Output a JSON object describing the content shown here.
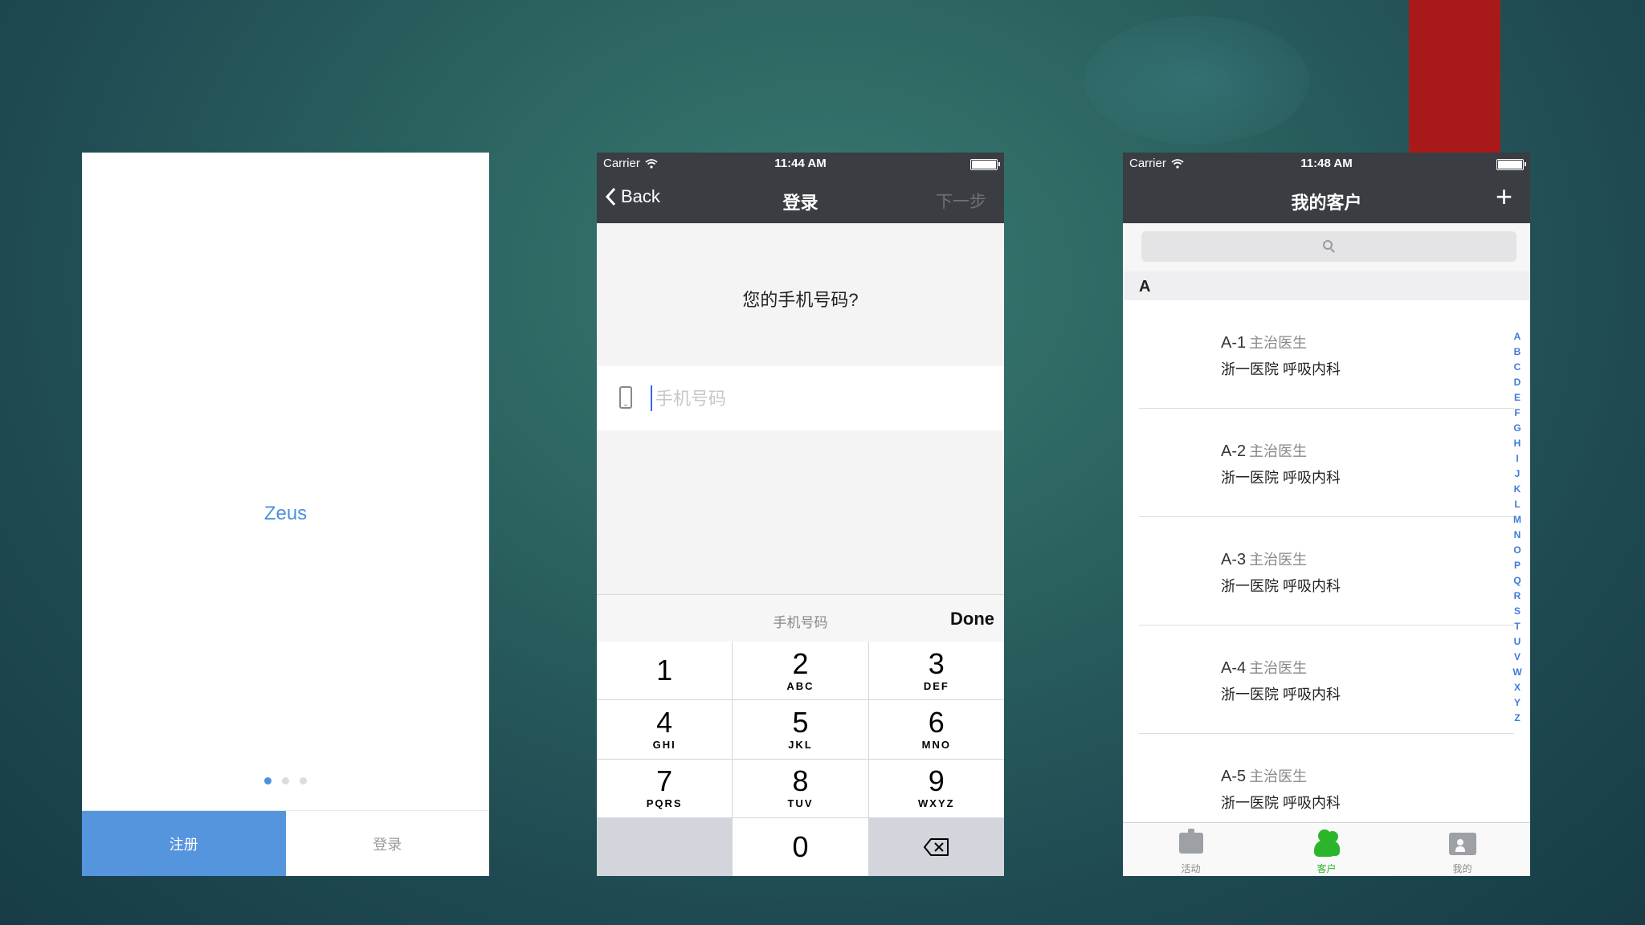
{
  "colors": {
    "background": "#2b6360",
    "accent_blue": "#4a90e2",
    "register_button": "#5595de",
    "navbar": "#3a3d42",
    "tab_active": "#2bb52b",
    "red_tab": "#a81a1a",
    "index_blue": "#3f7bd8"
  },
  "welcome": {
    "brand": "Zeus",
    "page_count": 3,
    "active_page": 1,
    "register_label": "注册",
    "login_label": "登录"
  },
  "login": {
    "status": {
      "carrier": "Carrier",
      "time": "11:44 AM"
    },
    "nav": {
      "back_label": "Back",
      "title": "登录",
      "next_label": "下一步"
    },
    "question": "您的手机号码?",
    "phone_placeholder": "手机号码",
    "phone_value": "",
    "keyboard": {
      "toolbar_hint": "手机号码",
      "done_label": "Done",
      "keys": [
        {
          "num": "1",
          "letters": ""
        },
        {
          "num": "2",
          "letters": "ABC"
        },
        {
          "num": "3",
          "letters": "DEF"
        },
        {
          "num": "4",
          "letters": "GHI"
        },
        {
          "num": "5",
          "letters": "JKL"
        },
        {
          "num": "6",
          "letters": "MNO"
        },
        {
          "num": "7",
          "letters": "PQRS"
        },
        {
          "num": "8",
          "letters": "TUV"
        },
        {
          "num": "9",
          "letters": "WXYZ"
        },
        {
          "num": "0",
          "letters": ""
        }
      ]
    }
  },
  "clients": {
    "status": {
      "carrier": "Carrier",
      "time": "11:48 AM"
    },
    "nav": {
      "title": "我的客户",
      "add_label": "+"
    },
    "section_letter": "A",
    "rows": [
      {
        "name": "A-1",
        "title": "主治医生",
        "hospital": "浙一医院 呼吸内科"
      },
      {
        "name": "A-2",
        "title": "主治医生",
        "hospital": "浙一医院 呼吸内科"
      },
      {
        "name": "A-3",
        "title": "主治医生",
        "hospital": "浙一医院 呼吸内科"
      },
      {
        "name": "A-4",
        "title": "主治医生",
        "hospital": "浙一医院 呼吸内科"
      },
      {
        "name": "A-5",
        "title": "主治医生",
        "hospital": "浙一医院 呼吸内科"
      }
    ],
    "alpha_index": [
      "A",
      "B",
      "C",
      "D",
      "E",
      "F",
      "G",
      "H",
      "I",
      "J",
      "K",
      "L",
      "M",
      "N",
      "O",
      "P",
      "Q",
      "R",
      "S",
      "T",
      "U",
      "V",
      "W",
      "X",
      "Y",
      "Z"
    ],
    "tabs": [
      {
        "label": "活动",
        "icon": "activity-icon"
      },
      {
        "label": "客户",
        "icon": "customers-icon",
        "active": true
      },
      {
        "label": "我的",
        "icon": "profile-card-icon"
      }
    ]
  }
}
